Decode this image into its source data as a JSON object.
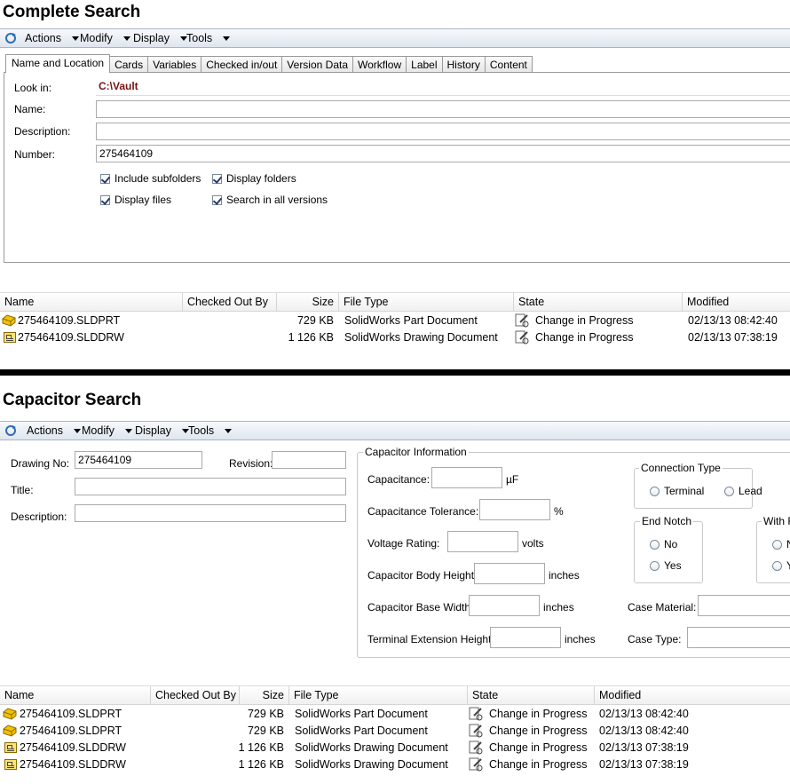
{
  "complete_search": {
    "title": "Complete Search",
    "toolbar": {
      "actions": "Actions",
      "modify": "Modify",
      "display": "Display",
      "tools": "Tools"
    },
    "tabs": [
      "Name and Location",
      "Cards",
      "Variables",
      "Checked in/out",
      "Version Data",
      "Workflow",
      "Label",
      "History",
      "Content"
    ],
    "form": {
      "look_in_label": "Look in:",
      "look_in_value": "C:\\Vault",
      "name_label": "Name:",
      "name_value": "",
      "description_label": "Description:",
      "description_value": "",
      "number_label": "Number:",
      "number_value": "275464109",
      "include_subfolders": "Include subfolders",
      "display_folders": "Display folders",
      "display_files": "Display files",
      "search_all_versions": "Search in all versions"
    },
    "columns": [
      "Name",
      "Checked Out By",
      "Size",
      "File Type",
      "State",
      "Modified"
    ],
    "rows": [
      {
        "name": "275464109.SLDPRT",
        "checked_out_by": "",
        "size": "729 KB",
        "file_type": "SolidWorks Part Document",
        "state": "Change in Progress",
        "modified": "02/13/13 08:42:40",
        "icon": "part-icon"
      },
      {
        "name": "275464109.SLDDRW",
        "checked_out_by": "",
        "size": "1 126 KB",
        "file_type": "SolidWorks Drawing Document",
        "state": "Change in Progress",
        "modified": "02/13/13 07:38:19",
        "icon": "drawing-icon"
      }
    ]
  },
  "capacitor_search": {
    "title": "Capacitor Search",
    "toolbar": {
      "actions": "Actions",
      "modify": "Modify",
      "display": "Display",
      "tools": "Tools"
    },
    "form": {
      "drawing_no_label": "Drawing No:",
      "drawing_no_value": "275464109",
      "revision_label": "Revision:",
      "revision_value": "",
      "title_label": "Title:",
      "title_value": "",
      "description_label": "Description:",
      "description_value": ""
    },
    "capacitor_info": {
      "group_title": "Capacitor Information",
      "capacitance_label": "Capacitance:",
      "capacitance_unit": "µF",
      "tolerance_label": "Capacitance Tolerance:",
      "tolerance_unit": "%",
      "voltage_label": "Voltage Rating:",
      "voltage_unit": "volts",
      "body_height_label": "Capacitor Body Height:",
      "body_height_unit": "inches",
      "base_width_label": "Capacitor Base Width:",
      "base_width_unit": "inches",
      "terminal_ext_label": "Terminal Extension Height:",
      "terminal_ext_unit": "inches",
      "connection_type": {
        "title": "Connection Type",
        "opt1": "Terminal",
        "opt2": "Lead"
      },
      "end_notch": {
        "title": "End Notch",
        "opt1": "No",
        "opt2": "Yes"
      },
      "with_f": {
        "title": "With F",
        "opt1": "N",
        "opt2": "Y"
      },
      "case_material_label": "Case Material:",
      "case_type_label": "Case Type:"
    },
    "columns": [
      "Name",
      "Checked Out By",
      "Size",
      "File Type",
      "State",
      "Modified"
    ],
    "rows": [
      {
        "name": "275464109.SLDPRT",
        "checked_out_by": "",
        "size": "729 KB",
        "file_type": "SolidWorks Part Document",
        "state": "Change in Progress",
        "modified": "02/13/13 08:42:40",
        "icon": "part-icon"
      },
      {
        "name": "275464109.SLDPRT",
        "checked_out_by": "",
        "size": "729 KB",
        "file_type": "SolidWorks Part Document",
        "state": "Change in Progress",
        "modified": "02/13/13 08:42:40",
        "icon": "part-icon"
      },
      {
        "name": "275464109.SLDDRW",
        "checked_out_by": "",
        "size": "1 126 KB",
        "file_type": "SolidWorks Drawing Document",
        "state": "Change in Progress",
        "modified": "02/13/13 07:38:19",
        "icon": "drawing-icon"
      },
      {
        "name": "275464109.SLDDRW",
        "checked_out_by": "",
        "size": "1 126 KB",
        "file_type": "SolidWorks Drawing Document",
        "state": "Change in Progress",
        "modified": "02/13/13 07:38:19",
        "icon": "drawing-icon"
      }
    ]
  },
  "colors": {
    "toolbar_border": "#a9b5c4",
    "look_in_text": "#7a1010",
    "grid_border": "#d5d5d5"
  }
}
